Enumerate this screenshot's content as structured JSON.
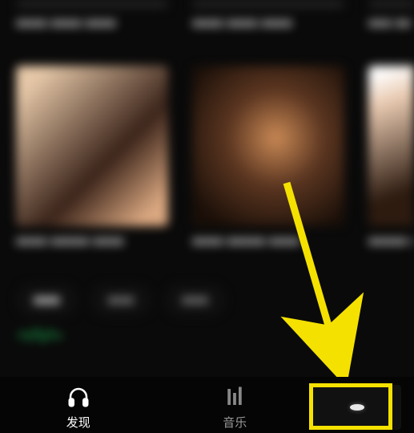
{
  "cards": {
    "r0c0": {
      "title": "■■■■ ■■■■\n■■■■"
    },
    "r0c1": {
      "title": "■■■■ ■■■■\n■■■■"
    },
    "r0c2": {
      "title": "■■■\n■■"
    },
    "r1c0": {
      "title": "■■■■ ■■■■■\n■■■■"
    },
    "r1c1": {
      "title": "■■■■ ■■■■■\n■■■■"
    },
    "r1c2": {
      "title": "■■■■■\n■■■■"
    }
  },
  "chips": {
    "c0": "■■■",
    "c1": "■■■",
    "c2": "■■■"
  },
  "nav": {
    "discover": "发现",
    "music": "音乐"
  },
  "annotation": {
    "highlight_target": "mini-player",
    "arrow_color": "#f5e100"
  }
}
